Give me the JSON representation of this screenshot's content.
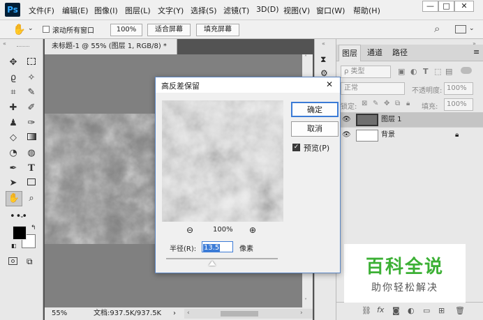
{
  "app": {
    "logo": "Ps"
  },
  "menu": [
    "文件(F)",
    "编辑(E)",
    "图像(I)",
    "图层(L)",
    "文字(Y)",
    "选择(S)",
    "滤镜(T)",
    "3D(D)",
    "视图(V)",
    "窗口(W)",
    "帮助(H)"
  ],
  "window_controls": {
    "minimize": "—",
    "maximize": "□",
    "close": "✕"
  },
  "options": {
    "scroll_all": "滚动所有窗口",
    "zoom": "100%",
    "fit_screen": "适合屏幕",
    "fill_screen": "填充屏幕"
  },
  "document": {
    "tab_title": "未标题-1 @ 55% (图层 1, RGB/8) *",
    "tab_close": "×",
    "zoom": "55%",
    "doc_info": "文档:937.5K/937.5K",
    "nav_arrow": "›"
  },
  "layers_panel": {
    "tabs": [
      "图层",
      "通道",
      "路径"
    ],
    "filter": "ρ 类型",
    "blend_mode": "正常",
    "opacity_label": "不透明度:",
    "opacity": "100%",
    "lock_label": "锁定:",
    "fill_label": "填充:",
    "fill": "100%",
    "layers": [
      {
        "name": "图层 1",
        "selected": true
      },
      {
        "name": "背景",
        "selected": false
      }
    ]
  },
  "dialog": {
    "title": "高反差保留",
    "close": "✕",
    "ok": "确定",
    "cancel": "取消",
    "preview_label": "预览(P)",
    "preview_checked": true,
    "zoom": "100%",
    "radius_label": "半径(R):",
    "radius_value": "13.5",
    "radius_unit": "像素"
  },
  "watermark": {
    "title": "百科全说",
    "subtitle": "助你轻松解决"
  },
  "colors": {
    "accent": "#3b7bd6",
    "watermark_green": "#3cb035",
    "dialog_border": "#5b86c4"
  }
}
